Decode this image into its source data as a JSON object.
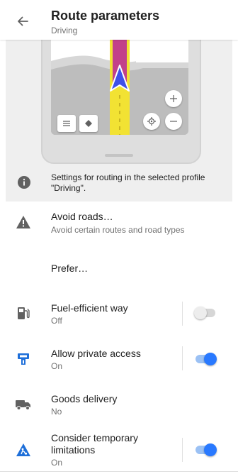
{
  "header": {
    "title": "Route parameters",
    "subtitle": "Driving"
  },
  "preview": {
    "route_color": "#c2408a",
    "road_color": "#f2e233",
    "arrow_color": "#3f51e8"
  },
  "info": {
    "text": "Settings for routing in the selected profile \"Driving\"."
  },
  "settings": {
    "avoid_roads": {
      "title": "Avoid roads…",
      "subtitle": "Avoid certain routes and road types"
    },
    "prefer": {
      "title": "Prefer…"
    },
    "fuel_efficient": {
      "title": "Fuel-efficient way",
      "status": "Off",
      "enabled": false
    },
    "private_access": {
      "title": "Allow private access",
      "status": "On",
      "enabled": true
    },
    "goods_delivery": {
      "title": "Goods delivery",
      "status": "No"
    },
    "temp_limitations": {
      "title_line1": "Consider temporary",
      "title_line2": "limitations",
      "status": "On",
      "enabled": true
    }
  },
  "colors": {
    "accent": "#2979ff",
    "icon_gray": "#616161",
    "icon_blue": "#1e6fd9"
  }
}
